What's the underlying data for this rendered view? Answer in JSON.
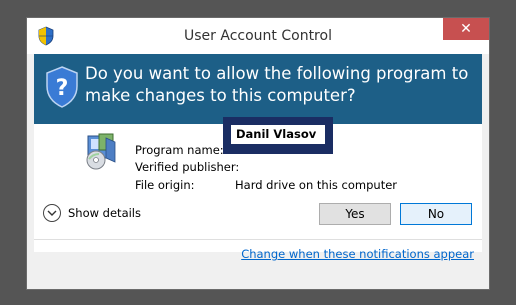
{
  "window": {
    "title": "User Account Control",
    "close_glyph": "✕"
  },
  "banner": {
    "question": "Do you want to allow the following program to make changes to this computer?"
  },
  "info": {
    "program_name_label": "Program name:",
    "program_name_value": "",
    "verified_publisher_label": "Verified publisher:",
    "verified_publisher_value": "Danil Vlasov",
    "file_origin_label": "File origin:",
    "file_origin_value": "Hard drive on this computer"
  },
  "footer": {
    "show_details": "Show details",
    "yes_label": "Yes",
    "no_label": "No",
    "notifications_link": "Change when these notifications appear"
  },
  "colors": {
    "banner_bg": "#1d5f87",
    "close_bg": "#c75050",
    "link": "#0066cc",
    "redaction_border": "#1a2d63"
  },
  "icons": {
    "title_icon": "uac-shield-icon",
    "banner_icon": "uac-shield-question-icon",
    "program_icon": "installer-disc-icon",
    "details_icon": "chevron-down-icon",
    "close_icon": "close-icon"
  }
}
